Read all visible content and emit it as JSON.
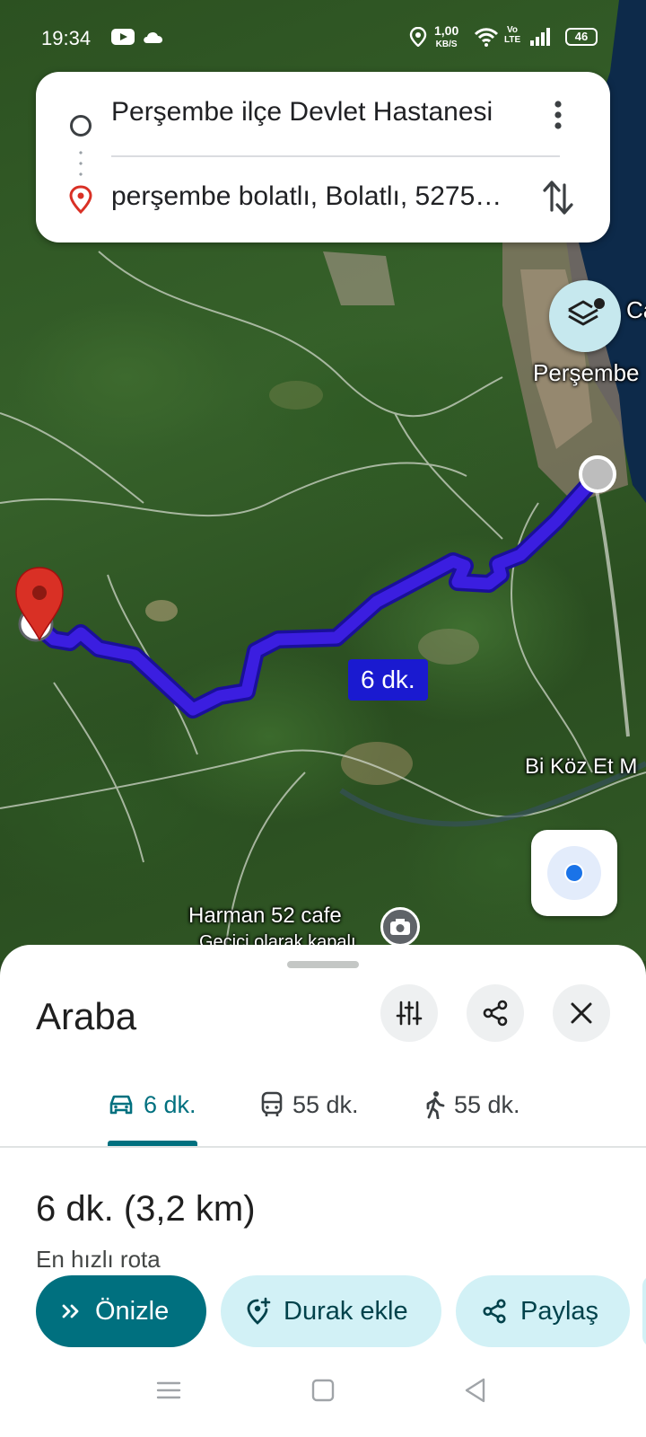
{
  "status_bar": {
    "time": "19:34",
    "net_speed_value": "1,00",
    "net_speed_unit": "KB/S",
    "volte": "Vo LTE",
    "battery": "46",
    "icons": [
      "youtube-icon",
      "cloud-icon",
      "location-icon",
      "wifi-icon",
      "signal-icon",
      "battery-icon"
    ]
  },
  "route_card": {
    "origin": "Perşembe ilçe Devlet Hastanesi",
    "destination": "perşembe bolatlı, Bolatlı, 5275…",
    "icons": [
      "origin-circle-icon",
      "destination-pin-icon",
      "more-vert-icon",
      "swap-icon"
    ]
  },
  "map": {
    "labels": {
      "town": "Perşembe",
      "town_cutoff": "Ca",
      "poi_1": "Bi Köz Et M",
      "poi_2": "Harman 52 cafe",
      "poi_2_sub": "Geçici olarak kapalı"
    },
    "route_eta": "6 dk.",
    "route_color": "#3b1ee0",
    "icons": [
      "layers-icon",
      "my-location-icon",
      "destination-marker-icon",
      "camera-icon"
    ]
  },
  "sheet": {
    "mode_title": "Araba",
    "header_buttons": [
      "tune-icon",
      "share-icon",
      "close-icon"
    ],
    "tabs": [
      {
        "icon": "car-icon",
        "label": "6 dk."
      },
      {
        "icon": "transit-icon",
        "label": "55 dk."
      },
      {
        "icon": "walk-icon",
        "label": "55 dk."
      }
    ],
    "summary_time": "6 dk.",
    "summary_distance": "(3,2 km)",
    "subtitle": "En hızlı rota",
    "actions": {
      "preview": "Önizle",
      "add_stop": "Durak ekle",
      "share": "Paylaş"
    },
    "accent_color": "#00707f"
  },
  "nav_bar": {
    "icons": [
      "menu-icon",
      "home-icon",
      "back-icon"
    ]
  }
}
